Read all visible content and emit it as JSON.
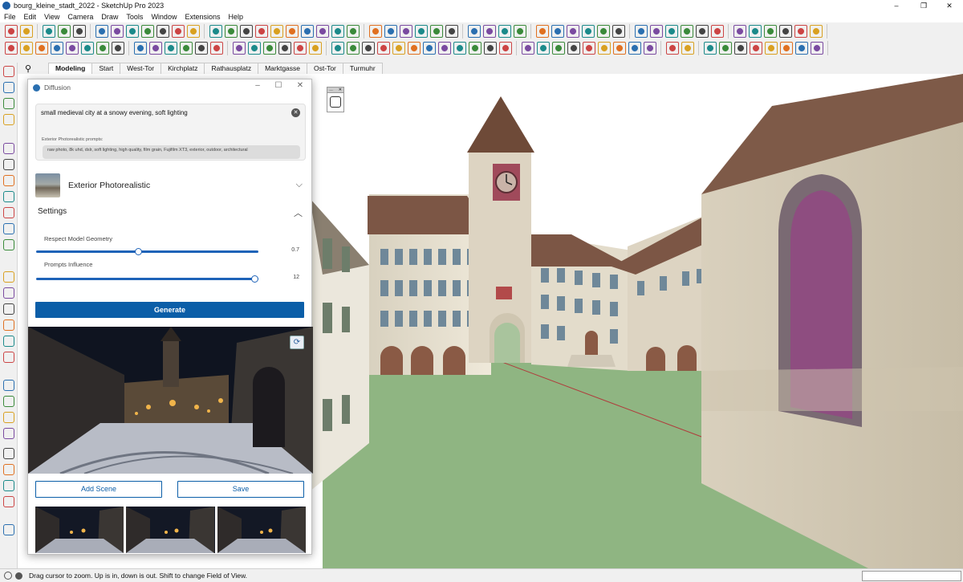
{
  "window": {
    "title": "bourg_kleine_stadt_2022 - SketchUp Pro 2023",
    "minimize": "–",
    "maximize": "❐",
    "close": "✕"
  },
  "menu": [
    "File",
    "Edit",
    "View",
    "Camera",
    "Draw",
    "Tools",
    "Window",
    "Extensions",
    "Help"
  ],
  "scene_tabs": [
    "Modeling",
    "Start",
    "West-Tor",
    "Kirchplatz",
    "Rathausplatz",
    "Marktgasse",
    "Ost-Tor",
    "Turmuhr"
  ],
  "active_scene": "Modeling",
  "diffusion": {
    "title": "Diffusion",
    "prompt": "small medieval city at a snowy evening, soft lighting",
    "style_prompt_label": "Exterior Photorealistic prompts:",
    "style_prompt": "raw photo, 8k uhd, dslr, soft lighting, high quality, film grain, Fujifilm XT3, exterior, outdoor, architectural",
    "style_name": "Exterior Photorealistic",
    "settings_label": "Settings",
    "sliders": [
      {
        "label": "Respect Model Geometry",
        "value": "0.7",
        "fraction": 0.46
      },
      {
        "label": "Prompts Influence",
        "value": "12",
        "fraction": 1.0
      }
    ],
    "generate_label": "Generate",
    "add_scene_label": "Add Scene",
    "save_label": "Save",
    "thumbnail_count": 3
  },
  "status": {
    "text": "Drag cursor to zoom.  Up is in, down is out. Shift to change Field of View."
  },
  "icons": {
    "app": "sketchup-icon",
    "zoom_tool": "magnifier-icon",
    "reload": "refresh-icon"
  },
  "colors": {
    "accent": "#0b5ea8",
    "ground": "#8fb582",
    "sky": "#ffffff"
  }
}
